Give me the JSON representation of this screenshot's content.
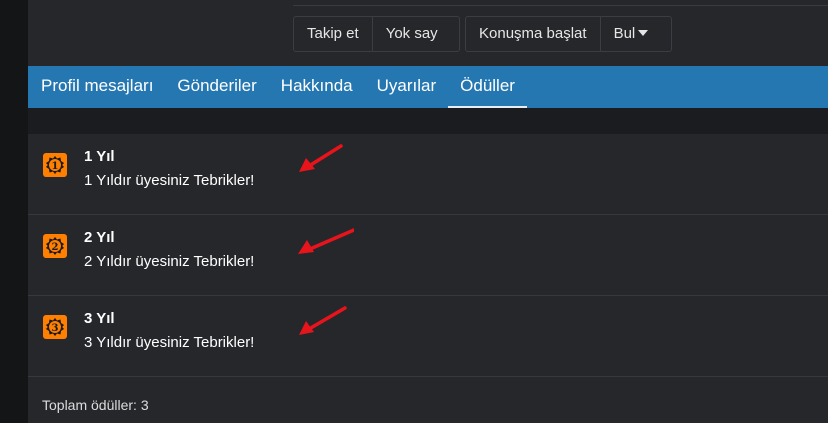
{
  "actions": {
    "follow_label": "Takip et",
    "ignore_label": "Yok say",
    "start_conversation_label": "Konuşma başlat",
    "find_label": "Bul"
  },
  "tabs": [
    {
      "label": "Profil mesajları"
    },
    {
      "label": "Gönderiler"
    },
    {
      "label": "Hakkında"
    },
    {
      "label": "Uyarılar"
    },
    {
      "label": "Ödüller",
      "active": true
    }
  ],
  "awards": [
    {
      "badge_number": "1",
      "title": "1 Yıl",
      "description": "1 Yıldır üyesiniz Tebrikler!"
    },
    {
      "badge_number": "2",
      "title": "2 Yıl",
      "description": "2 Yıldır üyesiniz Tebrikler!"
    },
    {
      "badge_number": "3",
      "title": "3 Yıl",
      "description": "3 Yıldır üyesiniz Tebrikler!"
    }
  ],
  "footer": {
    "total_label": "Toplam ödüller: 3"
  },
  "icons": {
    "badge": "award-badge-icon",
    "annotation": "red-arrow-icon"
  },
  "colors": {
    "tab_bar": "#2577b1",
    "badge": "#ff7f00",
    "arrow": "#e8141b",
    "panel": "#26272b"
  }
}
